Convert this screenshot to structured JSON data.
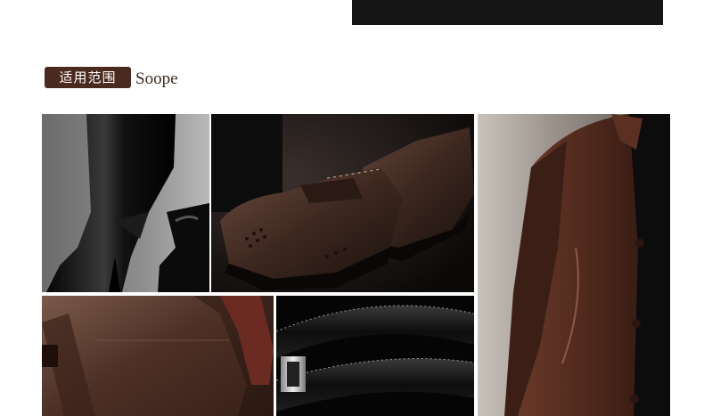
{
  "section": {
    "tag_cn": "适用范围",
    "title_en": "Soope"
  },
  "photos": [
    {
      "icon": "boots-photo"
    },
    {
      "icon": "brogue-shoes-photo"
    },
    {
      "icon": "leather-jacket-photo"
    },
    {
      "icon": "messenger-bag-photo"
    },
    {
      "icon": "leather-belt-photo"
    }
  ],
  "colors": {
    "tag_bg": "#4a2a1e",
    "leather_brown": "#4b2a1f",
    "leather_black": "#0e0e0e"
  }
}
